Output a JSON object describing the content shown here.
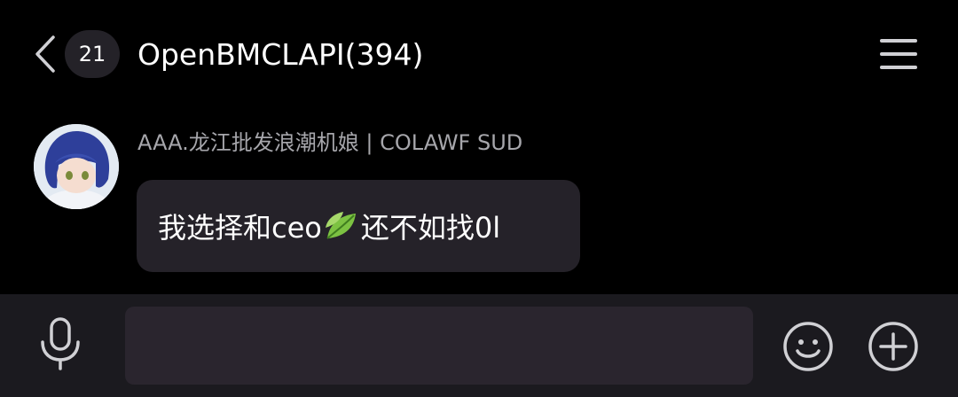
{
  "header": {
    "back_icon": "chevron-left-icon",
    "unread_count": "21",
    "title": "OpenBMCLAPI(394)",
    "menu_icon": "hamburger-menu-icon"
  },
  "message": {
    "sender_name": "AAA.龙江批发浪潮机娘 | COLAWF SUD",
    "text_before_emoji": "我选择和ceo",
    "emoji": "leaf-icon",
    "text_after_emoji": "还不如找0l"
  },
  "input_bar": {
    "mic_icon": "microphone-icon",
    "input_value": "",
    "input_placeholder": "",
    "emoji_icon": "smiley-icon",
    "plus_icon": "plus-circle-icon"
  },
  "colors": {
    "background": "#000000",
    "bubble": "#252229",
    "input_bar": "#1b1a1f",
    "input_field": "#2a252e",
    "sender_name": "#a6a6ab",
    "icon": "#d0d0d4"
  }
}
